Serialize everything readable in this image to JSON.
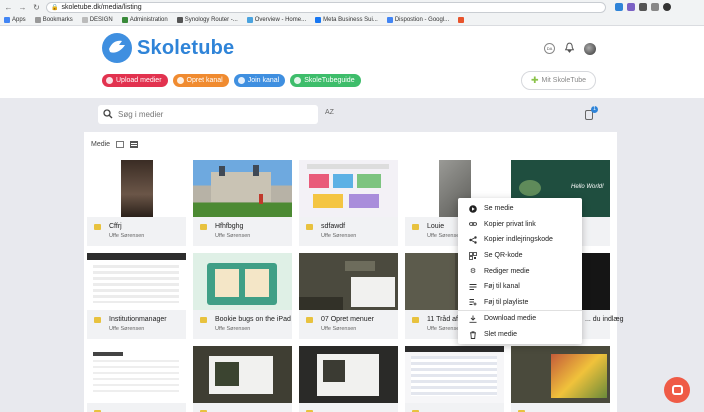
{
  "browser": {
    "url": "skoletube.dk/media/listing",
    "bookmarks": [
      "Apps",
      "Bookmarks",
      "DESIGN",
      "Administration",
      "Synology Router -...",
      "Overview - Home...",
      "Meta Business Sui...",
      "Dispostion - Googl..."
    ]
  },
  "header": {
    "logo_text": "Skoletube",
    "lang": "DA",
    "actions": [
      {
        "label": "Upload medier",
        "color": "#e2324f"
      },
      {
        "label": "Opret kanal",
        "color": "#f08b30"
      },
      {
        "label": "Join kanal",
        "color": "#3f8fe0"
      },
      {
        "label": "SkoleTubeguide",
        "color": "#3ebd6b"
      }
    ],
    "mit_label": "Mit SkoleTube"
  },
  "search": {
    "placeholder": "Søg i medier",
    "sort_label": "AZ",
    "notif_count": "1"
  },
  "view": {
    "label": "Medie"
  },
  "media": [
    {
      "title": "Cffrj",
      "author": "Uffe Sørensen"
    },
    {
      "title": "Hfhfbghg",
      "author": "Uffe Sørensen"
    },
    {
      "title": "sdfawdf",
      "author": "Uffe Sørensen"
    },
    {
      "title": "Louie",
      "author": "Uffe Sørensen"
    },
    {
      "title": "",
      "author": ""
    },
    {
      "title": "Institutionmanager",
      "author": "Uffe Sørensen"
    },
    {
      "title": "Bookie bugs on the iPad",
      "author": "Uffe Sørensen"
    },
    {
      "title": "07 Opret menuer",
      "author": "Uffe Sørensen"
    },
    {
      "title": "11 Tråd af ...",
      "author": "Uffe Sørensen"
    },
    {
      "title": "... du indlæg",
      "author": ""
    },
    {
      "title": "",
      "author": ""
    },
    {
      "title": "",
      "author": ""
    },
    {
      "title": "",
      "author": ""
    },
    {
      "title": "",
      "author": ""
    },
    {
      "title": "",
      "author": ""
    }
  ],
  "context_menu": [
    {
      "label": "Se medie",
      "icon": "play-icon"
    },
    {
      "label": "Kopier privat link",
      "icon": "link-icon"
    },
    {
      "label": "Kopier indlejringskode",
      "icon": "share-icon"
    },
    {
      "label": "Se QR-kode",
      "icon": "qr-icon"
    },
    {
      "label": "Rediger medie",
      "icon": "gear-icon"
    },
    {
      "label": "Føj til kanal",
      "icon": "list-icon"
    },
    {
      "label": "Føj til playliste",
      "icon": "playlist-add-icon"
    },
    {
      "label": "Download medie",
      "icon": "download-icon"
    },
    {
      "label": "Slet medie",
      "icon": "trash-icon"
    }
  ],
  "colors": {
    "brand": "#2f84d8",
    "panel": "#ffffff",
    "bg": "#e8e9ee"
  }
}
